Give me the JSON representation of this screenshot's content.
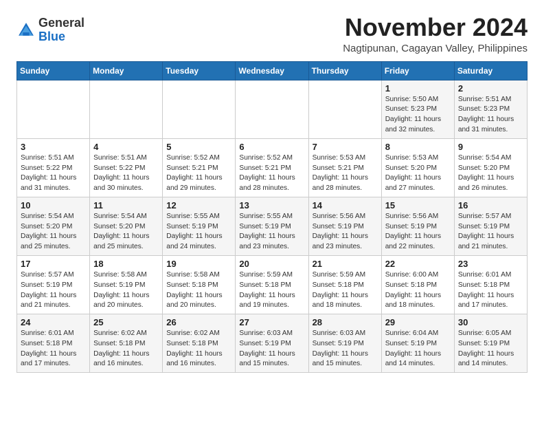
{
  "logo": {
    "general": "General",
    "blue": "Blue"
  },
  "header": {
    "month_title": "November 2024",
    "location": "Nagtipunan, Cagayan Valley, Philippines"
  },
  "days_of_week": [
    "Sunday",
    "Monday",
    "Tuesday",
    "Wednesday",
    "Thursday",
    "Friday",
    "Saturday"
  ],
  "weeks": [
    [
      {
        "day": "",
        "info": ""
      },
      {
        "day": "",
        "info": ""
      },
      {
        "day": "",
        "info": ""
      },
      {
        "day": "",
        "info": ""
      },
      {
        "day": "",
        "info": ""
      },
      {
        "day": "1",
        "info": "Sunrise: 5:50 AM\nSunset: 5:23 PM\nDaylight: 11 hours\nand 32 minutes."
      },
      {
        "day": "2",
        "info": "Sunrise: 5:51 AM\nSunset: 5:23 PM\nDaylight: 11 hours\nand 31 minutes."
      }
    ],
    [
      {
        "day": "3",
        "info": "Sunrise: 5:51 AM\nSunset: 5:22 PM\nDaylight: 11 hours\nand 31 minutes."
      },
      {
        "day": "4",
        "info": "Sunrise: 5:51 AM\nSunset: 5:22 PM\nDaylight: 11 hours\nand 30 minutes."
      },
      {
        "day": "5",
        "info": "Sunrise: 5:52 AM\nSunset: 5:21 PM\nDaylight: 11 hours\nand 29 minutes."
      },
      {
        "day": "6",
        "info": "Sunrise: 5:52 AM\nSunset: 5:21 PM\nDaylight: 11 hours\nand 28 minutes."
      },
      {
        "day": "7",
        "info": "Sunrise: 5:53 AM\nSunset: 5:21 PM\nDaylight: 11 hours\nand 28 minutes."
      },
      {
        "day": "8",
        "info": "Sunrise: 5:53 AM\nSunset: 5:20 PM\nDaylight: 11 hours\nand 27 minutes."
      },
      {
        "day": "9",
        "info": "Sunrise: 5:54 AM\nSunset: 5:20 PM\nDaylight: 11 hours\nand 26 minutes."
      }
    ],
    [
      {
        "day": "10",
        "info": "Sunrise: 5:54 AM\nSunset: 5:20 PM\nDaylight: 11 hours\nand 25 minutes."
      },
      {
        "day": "11",
        "info": "Sunrise: 5:54 AM\nSunset: 5:20 PM\nDaylight: 11 hours\nand 25 minutes."
      },
      {
        "day": "12",
        "info": "Sunrise: 5:55 AM\nSunset: 5:19 PM\nDaylight: 11 hours\nand 24 minutes."
      },
      {
        "day": "13",
        "info": "Sunrise: 5:55 AM\nSunset: 5:19 PM\nDaylight: 11 hours\nand 23 minutes."
      },
      {
        "day": "14",
        "info": "Sunrise: 5:56 AM\nSunset: 5:19 PM\nDaylight: 11 hours\nand 23 minutes."
      },
      {
        "day": "15",
        "info": "Sunrise: 5:56 AM\nSunset: 5:19 PM\nDaylight: 11 hours\nand 22 minutes."
      },
      {
        "day": "16",
        "info": "Sunrise: 5:57 AM\nSunset: 5:19 PM\nDaylight: 11 hours\nand 21 minutes."
      }
    ],
    [
      {
        "day": "17",
        "info": "Sunrise: 5:57 AM\nSunset: 5:19 PM\nDaylight: 11 hours\nand 21 minutes."
      },
      {
        "day": "18",
        "info": "Sunrise: 5:58 AM\nSunset: 5:19 PM\nDaylight: 11 hours\nand 20 minutes."
      },
      {
        "day": "19",
        "info": "Sunrise: 5:58 AM\nSunset: 5:18 PM\nDaylight: 11 hours\nand 20 minutes."
      },
      {
        "day": "20",
        "info": "Sunrise: 5:59 AM\nSunset: 5:18 PM\nDaylight: 11 hours\nand 19 minutes."
      },
      {
        "day": "21",
        "info": "Sunrise: 5:59 AM\nSunset: 5:18 PM\nDaylight: 11 hours\nand 18 minutes."
      },
      {
        "day": "22",
        "info": "Sunrise: 6:00 AM\nSunset: 5:18 PM\nDaylight: 11 hours\nand 18 minutes."
      },
      {
        "day": "23",
        "info": "Sunrise: 6:01 AM\nSunset: 5:18 PM\nDaylight: 11 hours\nand 17 minutes."
      }
    ],
    [
      {
        "day": "24",
        "info": "Sunrise: 6:01 AM\nSunset: 5:18 PM\nDaylight: 11 hours\nand 17 minutes."
      },
      {
        "day": "25",
        "info": "Sunrise: 6:02 AM\nSunset: 5:18 PM\nDaylight: 11 hours\nand 16 minutes."
      },
      {
        "day": "26",
        "info": "Sunrise: 6:02 AM\nSunset: 5:18 PM\nDaylight: 11 hours\nand 16 minutes."
      },
      {
        "day": "27",
        "info": "Sunrise: 6:03 AM\nSunset: 5:19 PM\nDaylight: 11 hours\nand 15 minutes."
      },
      {
        "day": "28",
        "info": "Sunrise: 6:03 AM\nSunset: 5:19 PM\nDaylight: 11 hours\nand 15 minutes."
      },
      {
        "day": "29",
        "info": "Sunrise: 6:04 AM\nSunset: 5:19 PM\nDaylight: 11 hours\nand 14 minutes."
      },
      {
        "day": "30",
        "info": "Sunrise: 6:05 AM\nSunset: 5:19 PM\nDaylight: 11 hours\nand 14 minutes."
      }
    ]
  ]
}
